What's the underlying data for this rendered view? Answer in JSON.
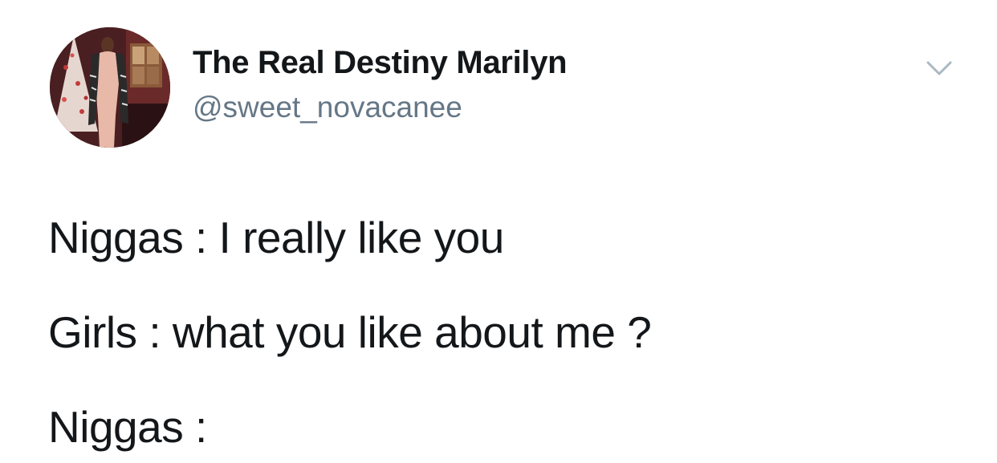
{
  "tweet": {
    "author": {
      "display_name": "The Real Destiny Marilyn",
      "handle": "@sweet_novacanee"
    },
    "menu_icon": "chevron-down-icon",
    "lines": [
      "Niggas : I really like you",
      "Girls : what you like about me ?",
      "Niggas :"
    ]
  },
  "colors": {
    "text_primary": "#14171a",
    "text_secondary": "#657786",
    "caret": "#aab8c2",
    "background": "#ffffff"
  }
}
